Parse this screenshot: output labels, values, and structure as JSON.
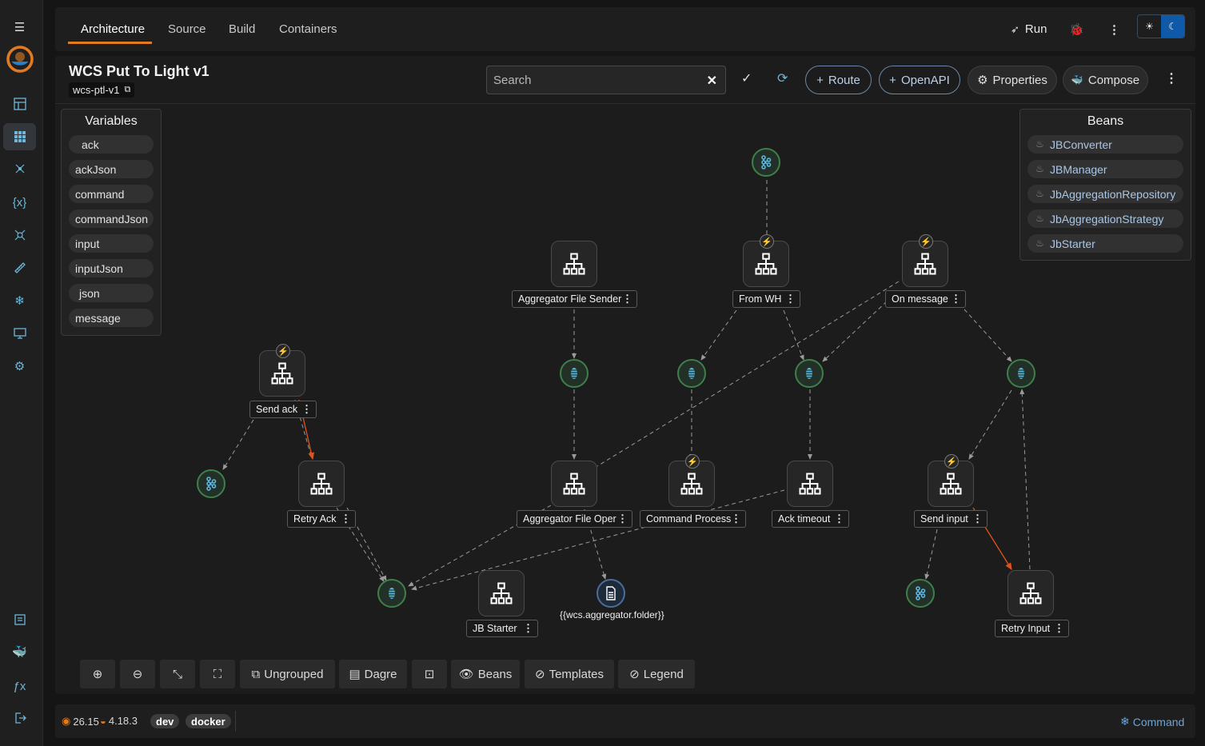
{
  "sidebar": {
    "icons": [
      "hamburger-icon",
      "logo-icon",
      "dashboard-icon",
      "grid-icon",
      "topology-icon",
      "braces-icon",
      "network-icon",
      "ruler-icon",
      "snowflake-icon",
      "monitor-icon",
      "gear-icon",
      "document-icon",
      "docker-icon",
      "function-icon",
      "logout-icon"
    ]
  },
  "topbar": {
    "tabs": [
      "Architecture",
      "Source",
      "Build",
      "Containers"
    ],
    "run_label": "Run"
  },
  "header": {
    "title": "WCS Put To Light v1",
    "subtitle": "wcs-ptl-v1",
    "search_placeholder": "Search",
    "buttons": {
      "route": "Route",
      "openapi": "OpenAPI",
      "properties": "Properties",
      "compose": "Compose"
    }
  },
  "variables": {
    "title": "Variables",
    "items": [
      "ack",
      "ackJson",
      "command",
      "commandJson",
      "input",
      "inputJson",
      "json",
      "message"
    ]
  },
  "beans": {
    "title": "Beans",
    "items": [
      "JBConverter",
      "JBManager",
      "JbAggregationRepository",
      "JbAggregationStrategy",
      "JbStarter"
    ]
  },
  "nodes": {
    "aggregator_file_sender": "Aggregator File Sender",
    "from_wh": "From WH",
    "on_message": "On message",
    "send_ack": "Send ack",
    "retry_ack": "Retry Ack",
    "aggregator_file_oper": "Aggregator File Oper",
    "command_process": "Command Process",
    "ack_timeout": "Ack timeout",
    "send_input": "Send input",
    "jb_starter": "JB Starter",
    "retry_input": "Retry Input",
    "file_endpoint": "{{wcs.aggregator.folder}}"
  },
  "toolbar": {
    "ungrouped": "Ungrouped",
    "dagre": "Dagre",
    "beans": "Beans",
    "templates": "Templates",
    "legend": "Legend"
  },
  "status": {
    "version1": "26.15",
    "version2": "4.18.3",
    "badge_dev": "dev",
    "badge_docker": "docker",
    "command": "Command"
  },
  "colors": {
    "accent": "#e07b22",
    "link": "#6ea3d8",
    "edge": "#9a9a9a",
    "error_edge": "#e0531c"
  }
}
